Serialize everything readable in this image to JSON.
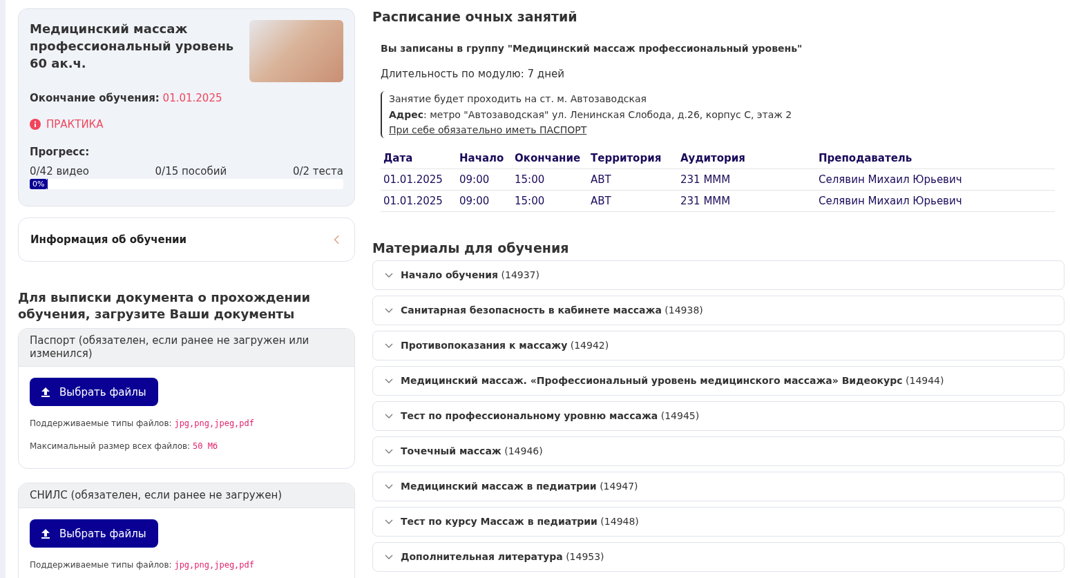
{
  "course": {
    "title": "Медицинский массаж профессиональный уровень 60 ак.ч.",
    "end_label": "Окончание обучения:",
    "end_date": "01.01.2025",
    "status": "ПРАКТИКА",
    "progress_label": "Прогресс:",
    "counters": [
      "0/42 видео",
      "0/15 пособий",
      "0/2 теста"
    ],
    "progress": {
      "level": 0,
      "label": "0%"
    }
  },
  "info_panel": {
    "title": "Информация об обучении",
    "expanded": false
  },
  "documents": {
    "title": "Для выписки документа о прохождении обучения, загрузите Ваши документы",
    "items": [
      {
        "title": "Паспорт (обязателен, если ранее не загружен или изменился)",
        "button": "Выбрать файлы",
        "types_label": "Поддерживаемые типы файлов:",
        "types": "jpg,png,jpeg,pdf",
        "size_label": "Максимальный размер всех файлов:",
        "size": "50 Мб"
      },
      {
        "title": "СНИЛС (обязателен, если ранее не загружен)",
        "button": "Выбрать файлы",
        "types_label": "Поддерживаемые типы файлов:",
        "types": "jpg,png,jpeg,pdf"
      }
    ]
  },
  "schedule": {
    "title": "Расписание очных занятий",
    "group": "Вы записаны в группу \"Медицинский массаж профессиональный уровень\"",
    "duration": "Длительность по модулю: 7 дней",
    "note_lines": [
      "Занятие будет проходить на ст. м. Автозаводская",
      "**Адрес**: метро \"Автозаводская\" ул. Ленинская Слобода, д.26, корпус С, этаж 2"
    ],
    "note_link": "При себе обязательно иметь ПАСПОРТ",
    "columns": [
      "Дата",
      "Начало",
      "Окончание",
      "Территория",
      "Аудитория",
      "Преподаватель"
    ],
    "rows": [
      [
        "01.01.2025",
        "09:00",
        "15:00",
        "АВТ",
        "231 МММ",
        "Селявин Михаил Юрьевич"
      ],
      [
        "01.01.2025",
        "09:00",
        "15:00",
        "АВТ",
        "231 МММ",
        "Селявин Михаил Юрьевич"
      ]
    ]
  },
  "materials": {
    "title": "Материалы для обучения",
    "items": [
      {
        "name": "Начало обучения",
        "count": "(14937)",
        "expanded": false
      },
      {
        "name": "Санитарная безопасность в кабинете массажа",
        "count": "(14938)",
        "expanded": false
      },
      {
        "name": "Противопоказания к массажу",
        "count": "(14942)",
        "expanded": false
      },
      {
        "name": "Медицинский массаж. «Профессиональный уровень медицинского массажа» Видеокурс",
        "count": "(14944)",
        "expanded": false
      },
      {
        "name": "Тест по профессиональному уровню массажа",
        "count": "(14945)",
        "expanded": false
      },
      {
        "name": "Точечный массаж",
        "count": "(14946)",
        "expanded": false
      },
      {
        "name": "Медицинский массаж в педиатрии",
        "count": "(14947)",
        "expanded": false
      },
      {
        "name": "Тест по курсу Массаж в педиатрии",
        "count": "(14948)",
        "expanded": false
      },
      {
        "name": "Дополнительная литература",
        "count": "(14953)",
        "expanded": false
      }
    ]
  }
}
